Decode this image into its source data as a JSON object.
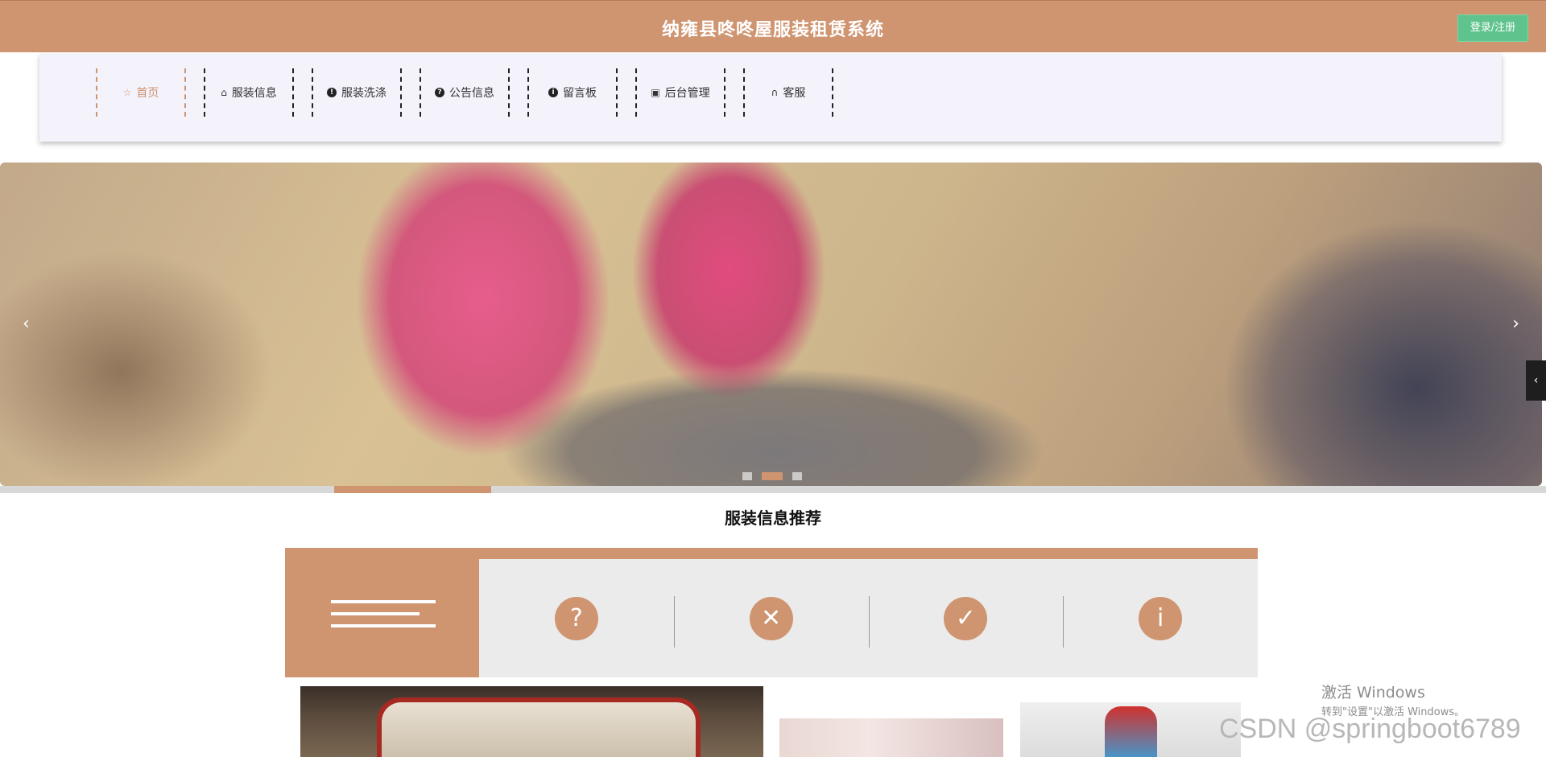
{
  "header": {
    "title": "纳雍县咚咚屋服装租赁系统",
    "login_label": "登录/注册"
  },
  "nav": {
    "items": [
      {
        "label": "首页",
        "icon": "star-icon",
        "active": true
      },
      {
        "label": "服装信息",
        "icon": "bag-icon"
      },
      {
        "label": "服装洗涤",
        "icon": "exclamation-circle-icon"
      },
      {
        "label": "公告信息",
        "icon": "question-circle-icon"
      },
      {
        "label": "留言板",
        "icon": "info-circle-icon"
      },
      {
        "label": "后台管理",
        "icon": "briefcase-icon"
      },
      {
        "label": "客服",
        "icon": "headset-icon"
      }
    ]
  },
  "banner": {
    "prev_label": "‹",
    "next_label": "›",
    "slide_count": 3,
    "active_slide": 2
  },
  "side_tab": {
    "label": "‹"
  },
  "section": {
    "title": "服装信息推荐",
    "filter_icons": [
      {
        "name": "question-icon",
        "glyph": "?"
      },
      {
        "name": "close-icon",
        "glyph": "✕"
      },
      {
        "name": "check-icon",
        "glyph": "✓"
      },
      {
        "name": "info-icon",
        "glyph": "i"
      }
    ]
  },
  "watermark": {
    "line1": "激活 Windows",
    "line2": "转到\"设置\"以激活 Windows。",
    "csdn": "CSDN @springboot6789"
  },
  "colors": {
    "accent": "#cf9470",
    "login_button": "#5fc38d",
    "nav_background": "#f4f3fc"
  }
}
